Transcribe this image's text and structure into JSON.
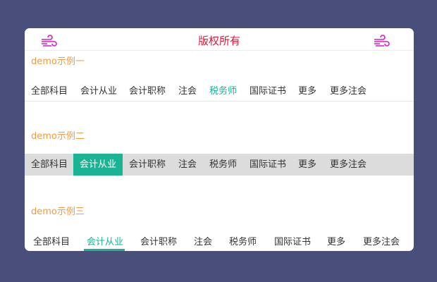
{
  "header": {
    "title": "版权所有",
    "left_icon": "wind-icon",
    "right_icon": "wind-icon",
    "icon_color": "#d61ec9"
  },
  "demo1": {
    "label": "demo示例一",
    "tabs": [
      "全部科目",
      "会计从业",
      "会计职称",
      "注会",
      "税务师",
      "国际证书",
      "更多",
      "更多注会"
    ],
    "active_index": 4
  },
  "demo2": {
    "label": "demo示例二",
    "tabs": [
      "全部科目",
      "会计从业",
      "会计职称",
      "注会",
      "税务师",
      "国际证书",
      "更多",
      "更多注会"
    ],
    "active_index": 1
  },
  "demo3": {
    "label": "demo示例三",
    "tabs": [
      "全部科目",
      "会计从业",
      "会计职称",
      "注会",
      "税务师",
      "国际证书",
      "更多",
      "更多注会"
    ],
    "active_index": 1
  },
  "colors": {
    "accent": "#1ab394",
    "label": "#f29a42",
    "title": "#e0173b",
    "background": "#4a4e7a"
  }
}
